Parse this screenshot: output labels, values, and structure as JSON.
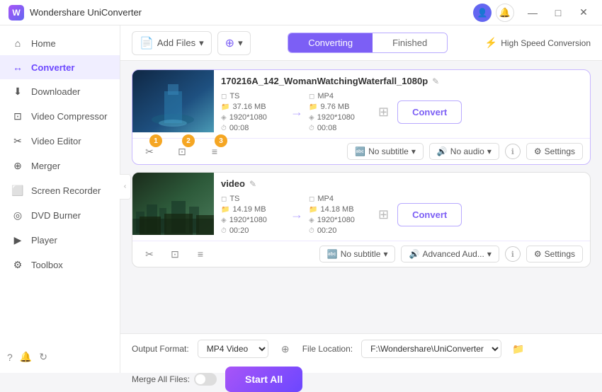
{
  "app": {
    "title": "Wondershare UniConverter",
    "logo_text": "W"
  },
  "title_bar": {
    "user_icon": "👤",
    "bell_label": "🔔",
    "minimize": "—",
    "maximize": "□",
    "close": "✕"
  },
  "sidebar": {
    "items": [
      {
        "id": "home",
        "label": "Home",
        "icon": "⌂"
      },
      {
        "id": "converter",
        "label": "Converter",
        "icon": "↔",
        "active": true
      },
      {
        "id": "downloader",
        "label": "Downloader",
        "icon": "⬇"
      },
      {
        "id": "video-compressor",
        "label": "Video Compressor",
        "icon": "⊡"
      },
      {
        "id": "video-editor",
        "label": "Video Editor",
        "icon": "✂"
      },
      {
        "id": "merger",
        "label": "Merger",
        "icon": "⊕"
      },
      {
        "id": "screen-recorder",
        "label": "Screen Recorder",
        "icon": "⬜"
      },
      {
        "id": "dvd-burner",
        "label": "DVD Burner",
        "icon": "◎"
      },
      {
        "id": "player",
        "label": "Player",
        "icon": "▶"
      },
      {
        "id": "toolbox",
        "label": "Toolbox",
        "icon": "⚙"
      }
    ],
    "footer_icons": [
      "?",
      "🔔",
      "↻"
    ]
  },
  "toolbar": {
    "add_files_label": "Add Files",
    "add_files_icon": "📄",
    "add_dropdown_icon": "▾",
    "second_btn_icon": "⊕",
    "second_btn_dropdown": "▾",
    "tabs": {
      "converting": "Converting",
      "finished": "Finished"
    },
    "active_tab": "Converting",
    "high_speed": "High Speed Conversion",
    "hs_icon": "⚡"
  },
  "files": [
    {
      "id": "file1",
      "name": "170216A_142_WomanWatchingWaterfall_1080p",
      "edit_icon": "✎",
      "source": {
        "format": "TS",
        "size": "37.16 MB",
        "resolution": "1920*1080",
        "duration": "00:08"
      },
      "target": {
        "format": "MP4",
        "size": "9.76 MB",
        "resolution": "1920*1080",
        "duration": "00:08"
      },
      "convert_btn": "Convert",
      "controls": {
        "cut": "✂",
        "crop": "⊡",
        "effects": "≡",
        "badges": [
          "1",
          "2",
          "3"
        ]
      },
      "subtitle": "No subtitle",
      "audio": "No audio",
      "settings": "Settings"
    },
    {
      "id": "file2",
      "name": "video",
      "edit_icon": "✎",
      "source": {
        "format": "TS",
        "size": "14.19 MB",
        "resolution": "1920*1080",
        "duration": "00:20"
      },
      "target": {
        "format": "MP4",
        "size": "14.18 MB",
        "resolution": "1920*1080",
        "duration": "00:20"
      },
      "convert_btn": "Convert",
      "controls": {
        "cut": "✂",
        "crop": "⊡",
        "effects": "≡"
      },
      "subtitle": "No subtitle",
      "audio": "Advanced Aud...",
      "settings": "Settings"
    }
  ],
  "bottom_bar": {
    "output_format_label": "Output Format:",
    "output_format_value": "MP4 Video",
    "output_format_icon": "⊕",
    "file_location_label": "File Location:",
    "file_location_value": "F:\\Wondershare\\UniConverter",
    "file_location_icon": "📁",
    "merge_label": "Merge All Files:",
    "start_all": "Start All"
  }
}
